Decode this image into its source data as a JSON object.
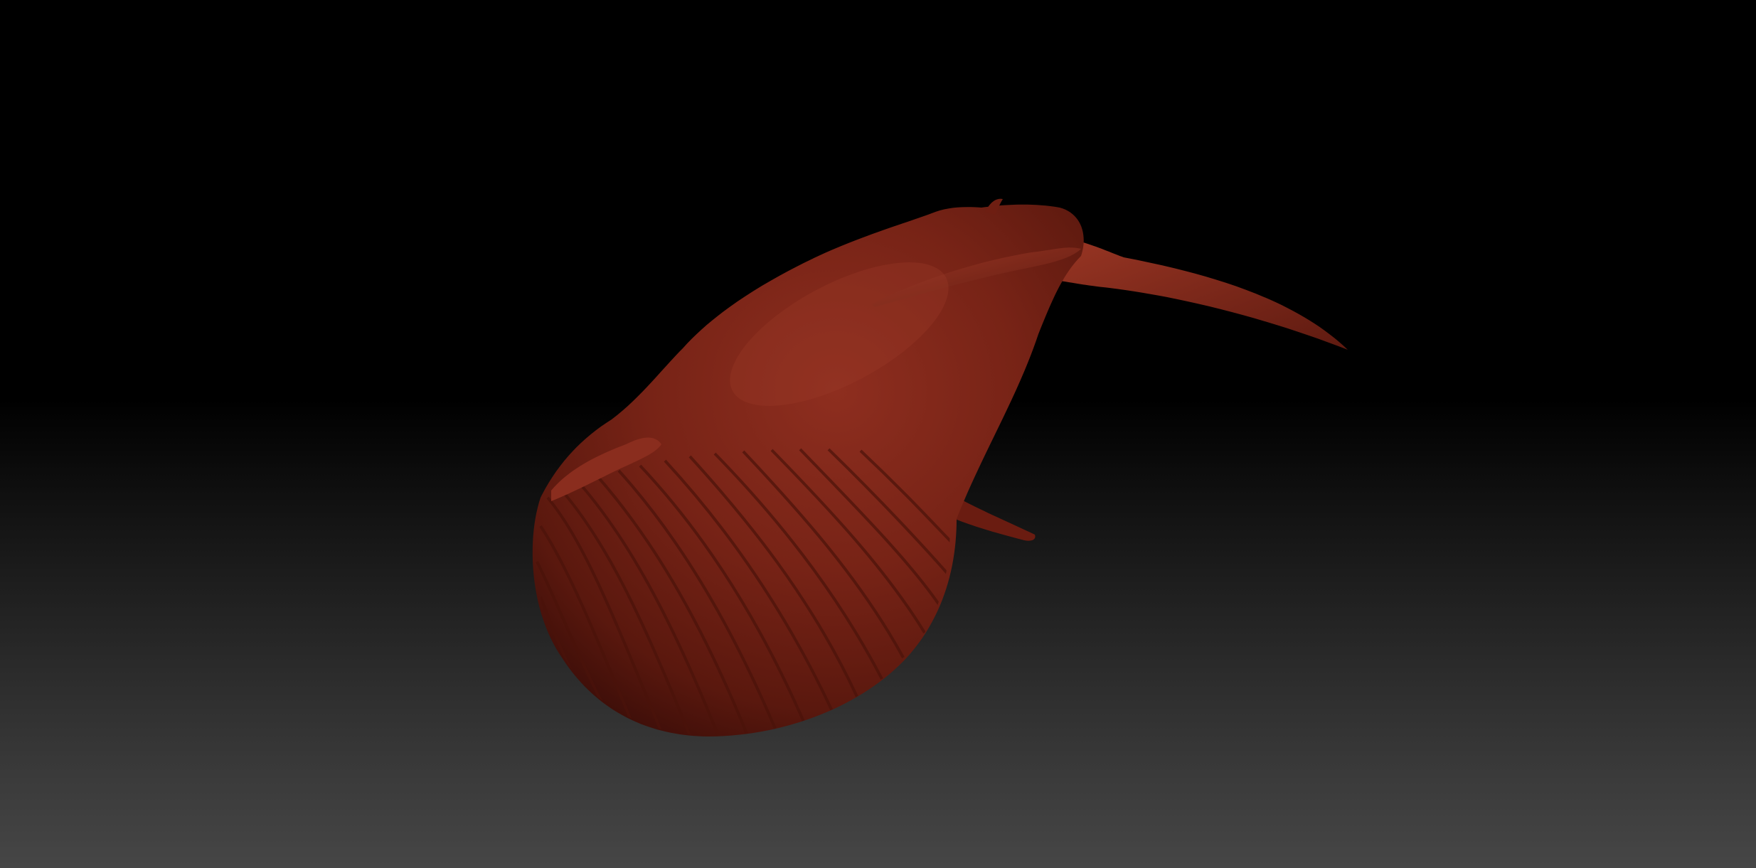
{
  "viewport": {
    "background_top": "#000000",
    "background_bottom": "#464646"
  },
  "model": {
    "subject": "whale",
    "material_color": "#7a2418",
    "material_highlight": "#a6402c",
    "material_shadow": "#3a0d08"
  }
}
